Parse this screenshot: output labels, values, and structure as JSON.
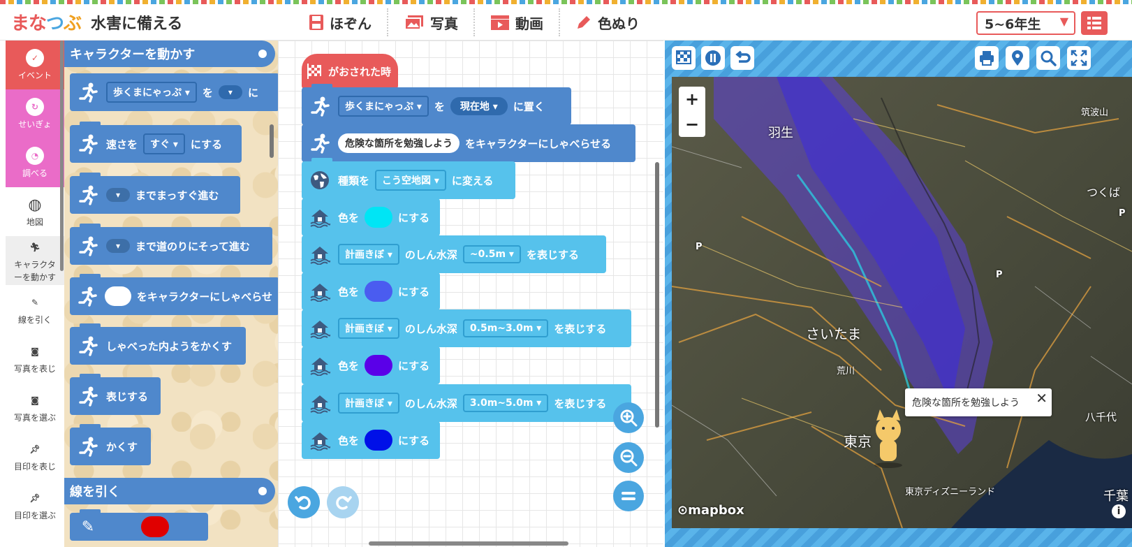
{
  "header": {
    "logo": [
      "まな",
      "つ",
      "ぶ"
    ],
    "title": "水害に備える",
    "menu": [
      "ほぞん",
      "写真",
      "動画",
      "色ぬり"
    ],
    "grade": "5~6年生"
  },
  "categories": [
    {
      "label": "イベント",
      "icon": "event-icon"
    },
    {
      "label": "せいぎょ",
      "icon": "control-icon"
    },
    {
      "label": "調べる",
      "icon": "search-icon"
    },
    {
      "label": "地図",
      "icon": "globe-icon"
    },
    {
      "label": "キャラクターを動かす",
      "icon": "runner-icon"
    },
    {
      "label": "線を引く",
      "icon": "pencil-icon"
    },
    {
      "label": "写真を表じ",
      "icon": "camera-icon"
    },
    {
      "label": "写真を選ぶ",
      "icon": "camera-icon"
    },
    {
      "label": "目印を表じ",
      "icon": "pin-icon"
    },
    {
      "label": "目印を選ぶ",
      "icon": "pin-icon"
    }
  ],
  "flyout": {
    "header1": "キャラクターを動かす",
    "header2": "線を引く",
    "blocks": [
      {
        "a": "歩くまにゃっぷ ▾",
        "b": "を",
        "c": "▾",
        "d": "に"
      },
      {
        "a": "速さを",
        "b": "すぐ ▾",
        "c": "にする"
      },
      {
        "a": "▾",
        "b": "までまっすぐ進む"
      },
      {
        "a": "▾",
        "b": "まで道のりにそって進む"
      },
      {
        "a": "",
        "b": "をキャラクターにしゃべらせ"
      },
      {
        "a": "しゃべった内ようをかくす"
      },
      {
        "a": "表じする"
      },
      {
        "a": "かくす"
      }
    ]
  },
  "workspace": {
    "hat": "がおされた時",
    "blocks": [
      {
        "a": "歩くまにゃっぷ ▾",
        "b": "を",
        "c": "現在地 ▾",
        "d": "に置く"
      },
      {
        "a": "危険な箇所を勉強しよう",
        "b": "をキャラクターにしゃべらせる"
      },
      {
        "a": "種類を",
        "b": "こう空地図 ▾",
        "c": "に変える"
      },
      {
        "a": "色を",
        "b": "にする",
        "color": "#00e5f5"
      },
      {
        "a": "計画きぼ ▾",
        "b": "のしん水深",
        "c": "~0.5m ▾",
        "d": "を表じする"
      },
      {
        "a": "色を",
        "b": "にする",
        "color": "#4a5cf0"
      },
      {
        "a": "計画きぼ ▾",
        "b": "のしん水深",
        "c": "0.5m~3.0m ▾",
        "d": "を表じする"
      },
      {
        "a": "色を",
        "b": "にする",
        "color": "#5a00e8"
      },
      {
        "a": "計画きぼ ▾",
        "b": "のしん水深",
        "c": "3.0m~5.0m ▾",
        "d": "を表じする"
      },
      {
        "a": "色を",
        "b": "にする",
        "color": "#0010e8"
      }
    ]
  },
  "map": {
    "labels": [
      "羽生",
      "筑波山",
      "つくば",
      "さいたま",
      "荒川",
      "東京",
      "八千代",
      "東京ディズニーランド",
      "千葉",
      "P",
      "P",
      "P"
    ],
    "popup": "危険な箇所を勉強しよう",
    "attribution": "mapbox",
    "zoom_in": "+",
    "zoom_out": "−"
  },
  "colors": {
    "accent": "#e85a5a",
    "block_blue": "#4f88cc",
    "block_light": "#56c2ec",
    "control_pink": "#ea6cc8",
    "map_frame": "#4aa6e0"
  }
}
